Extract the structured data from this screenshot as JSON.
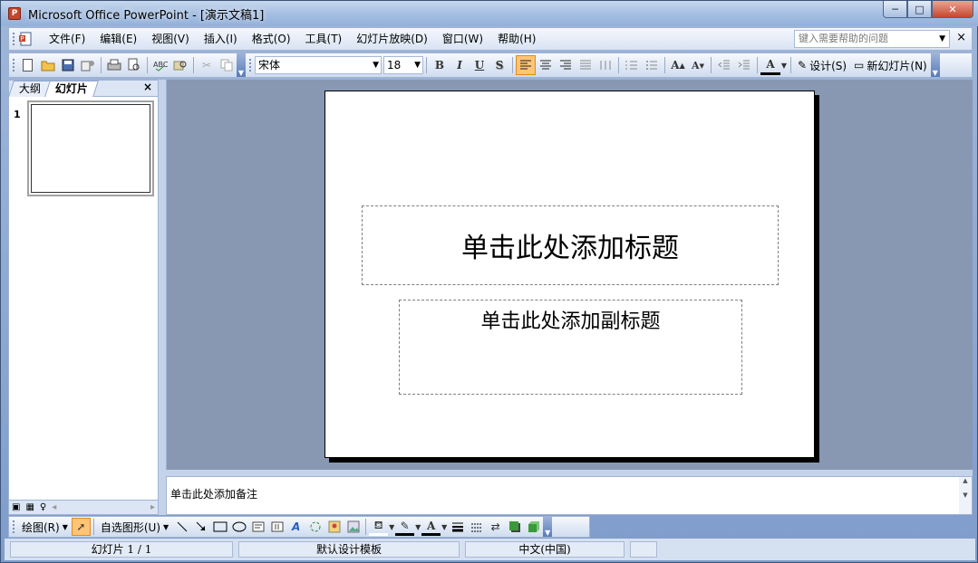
{
  "window": {
    "title": "Microsoft Office PowerPoint - [演示文稿1]",
    "minimize": "─",
    "maximize": "□",
    "close": "✕"
  },
  "menu": {
    "items": [
      "文件(F)",
      "编辑(E)",
      "视图(V)",
      "插入(I)",
      "格式(O)",
      "工具(T)",
      "幻灯片放映(D)",
      "窗口(W)",
      "帮助(H)"
    ],
    "help_placeholder": "键入需要帮助的问题",
    "close": "×"
  },
  "toolbar": {
    "font_name": "宋体",
    "font_size": "18",
    "bold": "B",
    "italic": "I",
    "underline": "U",
    "shadow": "S",
    "design_label": "设计(S)",
    "new_slide_label": "新幻灯片(N)"
  },
  "left_panel": {
    "tab_outline": "大纲",
    "tab_slides": "幻灯片",
    "close": "×",
    "slide_number": "1"
  },
  "slide": {
    "title_placeholder": "单击此处添加标题",
    "subtitle_placeholder": "单击此处添加副标题"
  },
  "notes": {
    "placeholder": "单击此处添加备注"
  },
  "drawbar": {
    "draw_label": "绘图(R)",
    "autoshapes_label": "自选图形(U)"
  },
  "status": {
    "slide_position": "幻灯片 1 / 1",
    "template": "默认设计模板",
    "language": "中文(中国)"
  },
  "colors": {
    "accent_active": "#ffc476",
    "edit_background": "#8898b2",
    "titlebar": "#a6bfe2"
  },
  "icons": {
    "menu_icon": "document-icon",
    "toolbar": [
      "new-icon",
      "open-icon",
      "save-icon",
      "permission-icon",
      "print-icon",
      "print-preview-icon",
      "spelling-icon",
      "research-icon",
      "cut-icon",
      "copy-icon"
    ]
  }
}
